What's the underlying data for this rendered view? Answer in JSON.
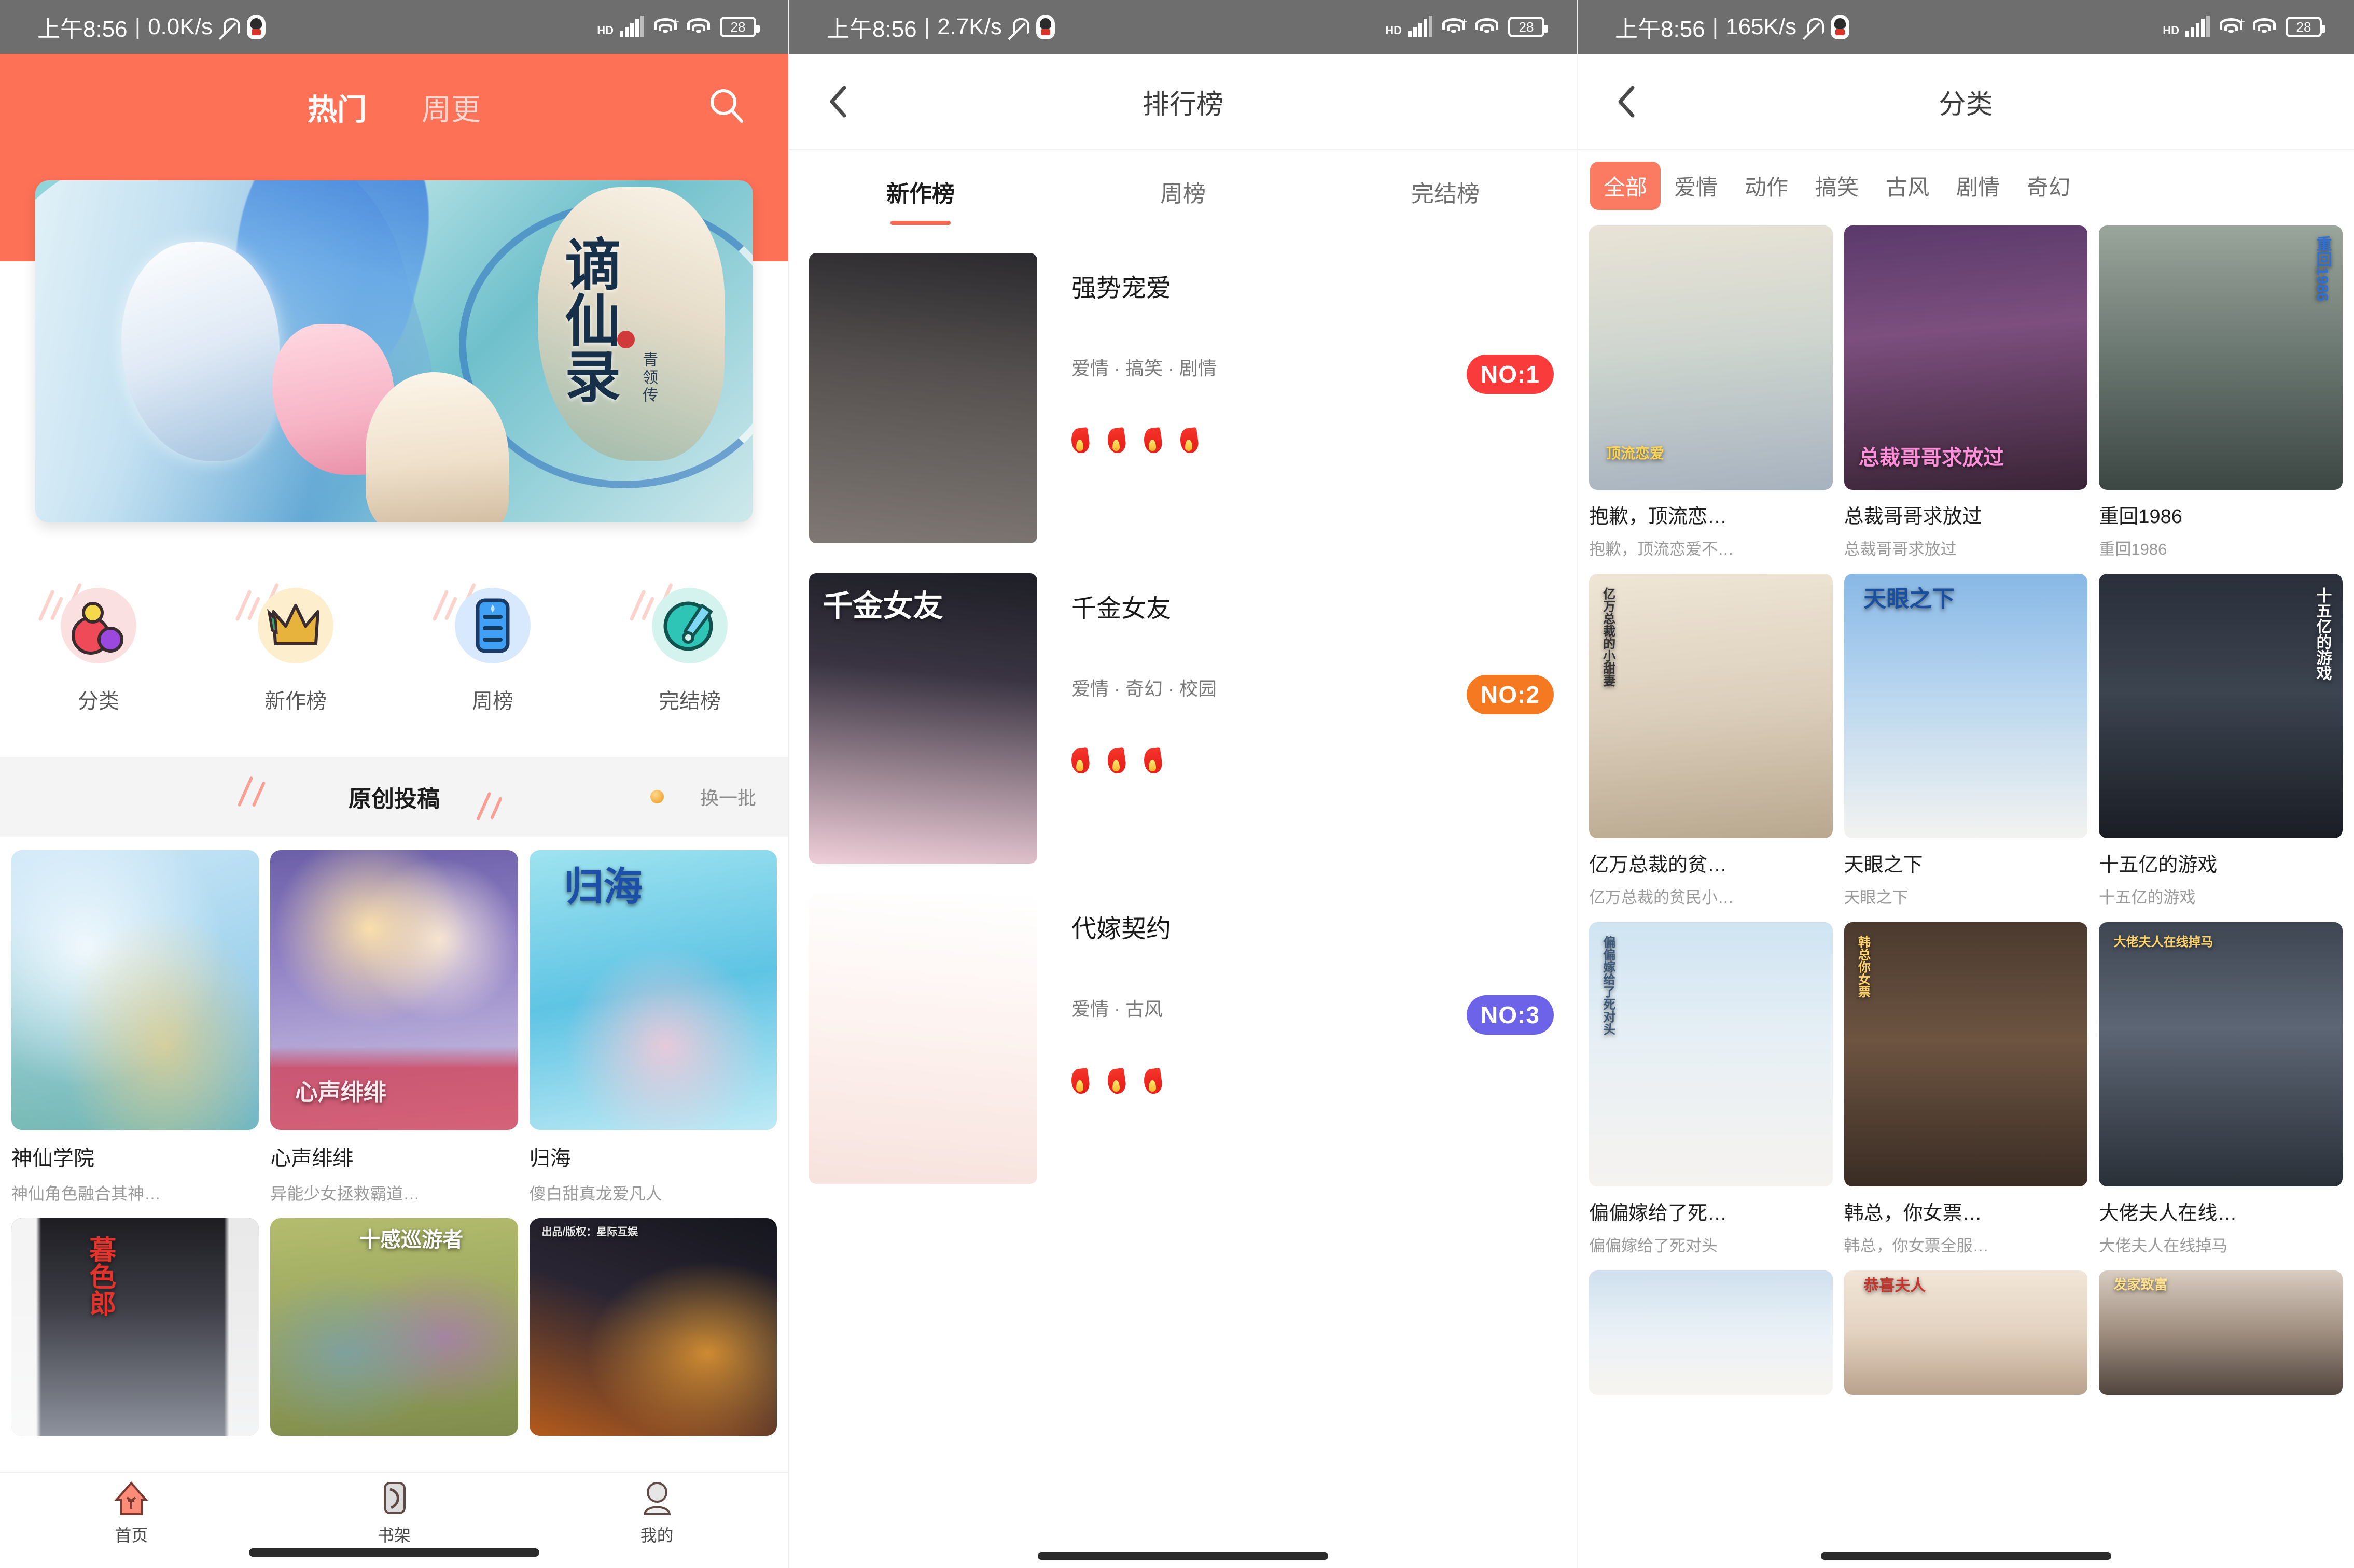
{
  "status_bars": [
    {
      "time": "上午8:56",
      "net_speed": "0.0K/s",
      "battery": "28",
      "hd": "HD"
    },
    {
      "time": "上午8:56",
      "net_speed": "2.7K/s",
      "battery": "28",
      "hd": "HD"
    },
    {
      "time": "上午8:56",
      "net_speed": "165K/s",
      "battery": "28",
      "hd": "HD"
    }
  ],
  "panel1": {
    "tabs": [
      {
        "label": "热门",
        "active": true
      },
      {
        "label": "周更",
        "active": false
      }
    ],
    "search_icon": "search-icon",
    "banner": {
      "title": "谪仙录",
      "subtitle": "青领传"
    },
    "quick_entries": [
      {
        "label": "分类",
        "icon": "category-icon",
        "accent": "#ef4a57"
      },
      {
        "label": "新作榜",
        "icon": "crown-icon",
        "accent": "#e8b33c"
      },
      {
        "label": "周榜",
        "icon": "list-icon",
        "accent": "#3fa0f5"
      },
      {
        "label": "完结榜",
        "icon": "brush-icon",
        "accent": "#2ec4b6"
      }
    ],
    "section": {
      "title": "原创投稿",
      "refresh_label": "换一批"
    },
    "cards": [
      {
        "title": "神仙学院",
        "desc": "神仙角色融合其神…"
      },
      {
        "title": "心声绯绯",
        "desc": "异能少女拯救霸道…"
      },
      {
        "title": "归海",
        "desc": "傻白甜真龙爱凡人"
      },
      {
        "title": "",
        "desc": "",
        "cover_text": "暮色郎"
      },
      {
        "title": "",
        "desc": "",
        "cover_text": "十感巡游者"
      },
      {
        "title": "",
        "desc": "",
        "cover_text": ""
      }
    ],
    "tabbar": [
      {
        "label": "首页",
        "icon": "home-icon",
        "active": true
      },
      {
        "label": "书架",
        "icon": "bookshelf-icon",
        "active": false
      },
      {
        "label": "我的",
        "icon": "profile-icon",
        "active": false
      }
    ]
  },
  "panel2": {
    "nav": {
      "title": "排行榜",
      "back_icon": "chevron-left-icon"
    },
    "tabs": [
      {
        "label": "新作榜",
        "active": true
      },
      {
        "label": "周榜",
        "active": false
      },
      {
        "label": "完结榜",
        "active": false
      }
    ],
    "rank_items": [
      {
        "title": "强势宠爱",
        "tags": "爱情 · 搞笑 · 剧情",
        "flames": 4,
        "badge": "NO:1",
        "badge_color": "#fa3b3b"
      },
      {
        "title": "千金女友",
        "tags": "爱情 · 奇幻 · 校园",
        "flames": 3,
        "badge": "NO:2",
        "badge_color": "#f47920",
        "cover_text": "千金女友"
      },
      {
        "title": "代嫁契约",
        "tags": "爱情 · 古风",
        "flames": 3,
        "badge": "NO:3",
        "badge_color": "#6c63e8"
      }
    ]
  },
  "panel3": {
    "nav": {
      "title": "分类",
      "back_icon": "chevron-left-icon"
    },
    "chips": [
      {
        "label": "全部",
        "active": true
      },
      {
        "label": "爱情",
        "active": false
      },
      {
        "label": "动作",
        "active": false
      },
      {
        "label": "搞笑",
        "active": false
      },
      {
        "label": "古风",
        "active": false
      },
      {
        "label": "剧情",
        "active": false
      },
      {
        "label": "奇幻",
        "active": false
      }
    ],
    "cards": [
      {
        "title": "抱歉，顶流恋…",
        "desc": "抱歉，顶流恋爱不…",
        "cover_text": "顶流恋爱"
      },
      {
        "title": "总裁哥哥求放过",
        "desc": "总裁哥哥求放过",
        "cover_text": "总裁哥哥求放过"
      },
      {
        "title": "重回1986",
        "desc": "重回1986",
        "cover_text": "重回1986"
      },
      {
        "title": "亿万总裁的贫…",
        "desc": "亿万总裁的贫民小…",
        "cover_text": "亿万总裁的小甜妻"
      },
      {
        "title": "天眼之下",
        "desc": "天眼之下",
        "cover_text": "天眼之下"
      },
      {
        "title": "十五亿的游戏",
        "desc": "十五亿的游戏",
        "cover_text": "十五亿的游戏"
      },
      {
        "title": "偏偏嫁给了死…",
        "desc": "偏偏嫁给了死对头",
        "cover_text": "偏偏嫁给了死对头"
      },
      {
        "title": "韩总，你女票…",
        "desc": "韩总，你女票全服…",
        "cover_text": "韩总你女票"
      },
      {
        "title": "大佬夫人在线…",
        "desc": "大佬夫人在线掉马",
        "cover_text": "大佬夫人在线掉马"
      },
      {
        "title": "",
        "desc": "",
        "cover_text": ""
      },
      {
        "title": "",
        "desc": "",
        "cover_text": "恭喜夫人"
      },
      {
        "title": "",
        "desc": "",
        "cover_text": "发家致富"
      }
    ]
  },
  "colors": {
    "brand_orange": "#fd7157",
    "accent_underline": "#f4684f",
    "chip_active": "#fa7a62",
    "status_bar": "#6e6e6e"
  }
}
